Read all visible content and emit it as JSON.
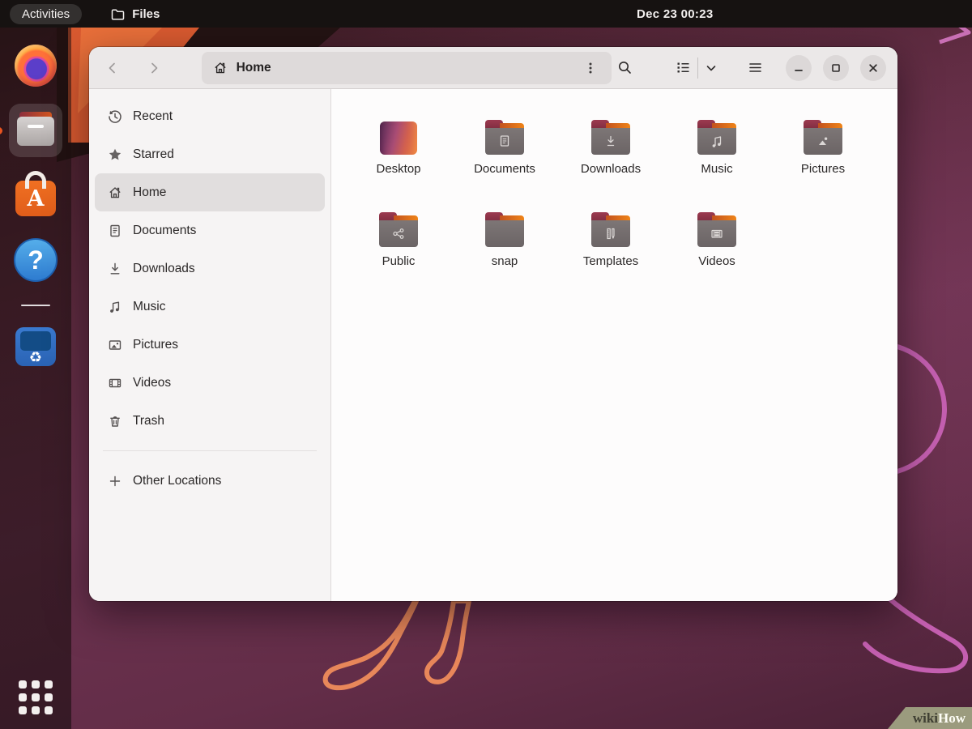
{
  "topbar": {
    "activities_label": "Activities",
    "files_menu_label": "Files",
    "clock": "Dec 23  00:23"
  },
  "dock": {
    "icons": [
      "firefox-icon",
      "files-icon",
      "ubuntu-software-icon",
      "help-icon",
      "trash-icon",
      "app-grid-icon"
    ],
    "active_app": "Files",
    "indicator_color": "#e95420"
  },
  "window": {
    "headerbar": {
      "path_label": "Home",
      "icons": [
        "back-icon",
        "forward-icon",
        "home-icon",
        "kebab-menu-icon",
        "search-icon",
        "list-view-icon",
        "chevron-down-icon",
        "hamburger-menu-icon",
        "minimize-icon",
        "maximize-icon",
        "close-icon"
      ]
    },
    "sidebar": {
      "items": [
        {
          "label": "Recent",
          "icon": "recent-icon"
        },
        {
          "label": "Starred",
          "icon": "starred-icon"
        },
        {
          "label": "Home",
          "icon": "home-icon",
          "selected": true
        },
        {
          "label": "Documents",
          "icon": "documents-icon"
        },
        {
          "label": "Downloads",
          "icon": "downloads-icon"
        },
        {
          "label": "Music",
          "icon": "music-icon"
        },
        {
          "label": "Pictures",
          "icon": "pictures-icon"
        },
        {
          "label": "Videos",
          "icon": "videos-icon"
        },
        {
          "label": "Trash",
          "icon": "trash-icon"
        }
      ],
      "other_locations_label": "Other Locations"
    },
    "files": {
      "items": [
        {
          "label": "Desktop",
          "icon": "desktop-gradient-icon"
        },
        {
          "label": "Documents",
          "icon": "folder-documents-icon"
        },
        {
          "label": "Downloads",
          "icon": "folder-downloads-icon"
        },
        {
          "label": "Music",
          "icon": "folder-music-icon"
        },
        {
          "label": "Pictures",
          "icon": "folder-pictures-icon"
        },
        {
          "label": "Public",
          "icon": "folder-share-icon"
        },
        {
          "label": "snap",
          "icon": "folder-plain-icon"
        },
        {
          "label": "Templates",
          "icon": "folder-templates-icon"
        },
        {
          "label": "Videos",
          "icon": "folder-videos-icon"
        }
      ]
    }
  },
  "watermark": {
    "wiki": "wiki",
    "how": "How"
  },
  "colors": {
    "topbar_bg": "#161211",
    "wallpaper_plum": "#66304b",
    "accent_orange": "#e95420",
    "folder_body": "#757070",
    "folder_tab": "#8b2f3f",
    "folder_strip": "#e07b1e",
    "header_bg": "#ebe8e8",
    "sidebar_bg": "#f6f4f4",
    "selection_bg": "#e1dede",
    "outline_pink": "#c45fb0",
    "outline_orange": "#e8875a"
  }
}
